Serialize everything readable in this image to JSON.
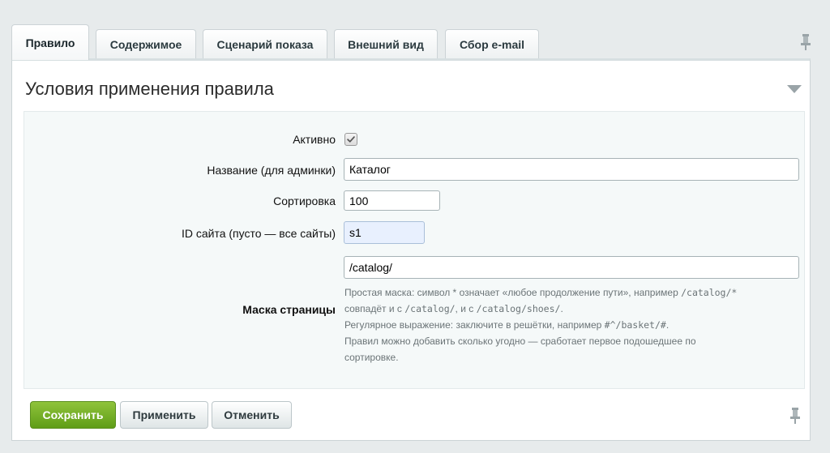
{
  "tabs": [
    {
      "label": "Правило",
      "active": true
    },
    {
      "label": "Содержимое",
      "active": false
    },
    {
      "label": "Сценарий показа",
      "active": false
    },
    {
      "label": "Внешний вид",
      "active": false
    },
    {
      "label": "Сбор e-mail",
      "active": false
    }
  ],
  "section": {
    "title": "Условия применения правила"
  },
  "form": {
    "active": {
      "label": "Активно",
      "checked": true
    },
    "name": {
      "label": "Название (для админки)",
      "value": "Каталог"
    },
    "sort": {
      "label": "Сортировка",
      "value": "100"
    },
    "site_id": {
      "label": "ID сайта (пусто — все сайты)",
      "value": "s1"
    },
    "mask": {
      "label": "Маска страницы",
      "value": "/catalog/",
      "hint": {
        "line1_a": "Простая маска: символ * означает «любое продолжение пути», например ",
        "line1_code": "/catalog/*",
        "line2_a": "совпадёт и с ",
        "line2_code1": "/catalog/",
        "line2_b": ", и с ",
        "line2_code2": "/catalog/shoes/",
        "line2_c": ".",
        "line3_a": "Регулярное выражение: заключите в решётки, например ",
        "line3_code": "#^/basket/#",
        "line3_b": ".",
        "line4": "Правил можно добавить сколько угодно — сработает первое подошедшее по сортировке."
      }
    }
  },
  "buttons": {
    "save": "Сохранить",
    "apply": "Применить",
    "cancel": "Отменить"
  },
  "icons": {
    "pin": "pin-icon",
    "collapse": "triangle-down-icon",
    "checkbox": "checkmark-icon"
  },
  "colors": {
    "primary": "#6aa820",
    "panel_bg": "#f5f9f9",
    "page_bg": "#e7ebec"
  }
}
